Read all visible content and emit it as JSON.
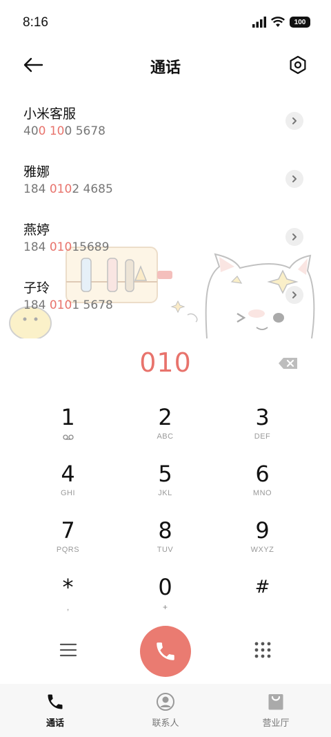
{
  "status_bar": {
    "time": "8:16",
    "battery": "100"
  },
  "header": {
    "title": "通话",
    "back_icon": "back-arrow-icon",
    "settings_icon": "settings-icon"
  },
  "results": [
    {
      "name": "小米客服",
      "number_parts": [
        "40",
        "0 10",
        "0 5678"
      ]
    },
    {
      "name": "雅娜",
      "number_parts": [
        "184 ",
        "010",
        "2 4685"
      ]
    },
    {
      "name": "燕婷",
      "number_parts": [
        "184 ",
        "010",
        "15689"
      ]
    },
    {
      "name": "子玲",
      "number_parts": [
        "184 ",
        "010",
        "1 5678"
      ]
    }
  ],
  "typed_number": "010",
  "keypad": [
    {
      "digit": "1",
      "letters": "",
      "icon": "voicemail-icon"
    },
    {
      "digit": "2",
      "letters": "ABC"
    },
    {
      "digit": "3",
      "letters": "DEF"
    },
    {
      "digit": "4",
      "letters": "GHI"
    },
    {
      "digit": "5",
      "letters": "JKL"
    },
    {
      "digit": "6",
      "letters": "MNO"
    },
    {
      "digit": "7",
      "letters": "PQRS"
    },
    {
      "digit": "8",
      "letters": "TUV"
    },
    {
      "digit": "9",
      "letters": "WXYZ"
    },
    {
      "digit": "*",
      "letters": ","
    },
    {
      "digit": "0",
      "letters": "+"
    },
    {
      "digit": "#",
      "letters": ""
    }
  ],
  "bottom_nav": [
    {
      "label": "通话",
      "icon": "phone-icon",
      "active": true
    },
    {
      "label": "联系人",
      "icon": "contacts-icon",
      "active": false
    },
    {
      "label": "营业厅",
      "icon": "store-bag-icon",
      "active": false
    }
  ],
  "colors": {
    "accent": "#e8736c",
    "call_button": "#ea7b71"
  }
}
